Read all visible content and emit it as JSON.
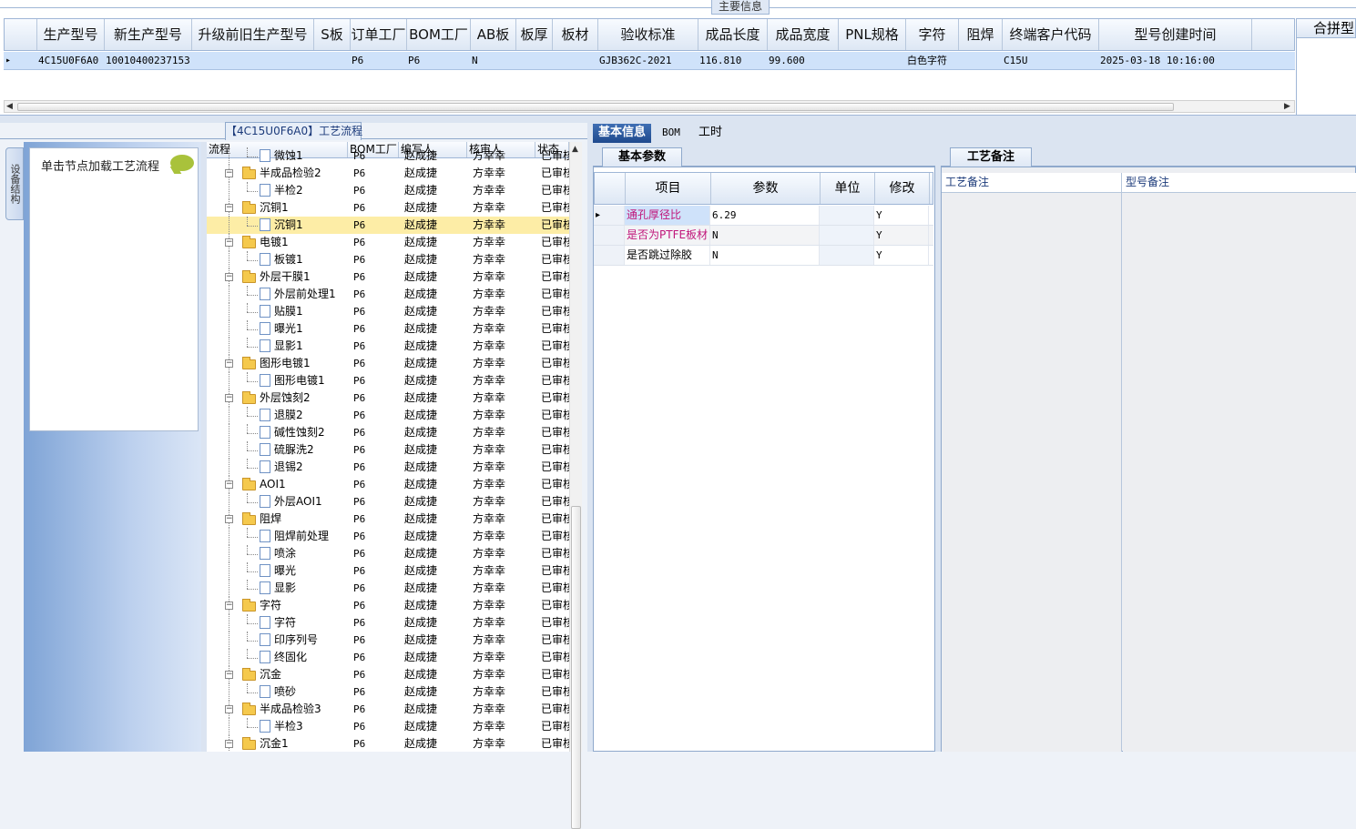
{
  "top_panel": {
    "title": "主要信息",
    "columns": [
      "生产型号",
      "新生产型号",
      "升级前旧生产型号",
      "S板",
      "订单工厂",
      "BOM工厂",
      "AB板",
      "板厚",
      "板材",
      "验收标准",
      "成品长度",
      "成品宽度",
      "PNL规格",
      "字符",
      "阻焊",
      "终端客户代码",
      "型号创建时间"
    ],
    "row": [
      "4C15U0F6A0",
      "10010400237153",
      "",
      "",
      "P6",
      "P6",
      "N",
      "",
      "",
      "GJB362C-2021",
      "116.810",
      "99.600",
      "",
      "白色字符",
      "",
      "C15U",
      "2025-03-18 10:16:00"
    ],
    "merge_header": "合拼型"
  },
  "flow_panel": {
    "title": "【4C15U0F6A0】工艺流程",
    "side_tab": "设备结构",
    "node_hint": "单击节点加载工艺流程",
    "columns": [
      "流程",
      "BOM工厂",
      "编写人",
      "核审人",
      "状态"
    ],
    "rows": [
      {
        "label": "微蚀1",
        "level": 2,
        "type": "doc",
        "bom": "P6",
        "writer": "赵成捷",
        "reviewer": "方幸幸",
        "status": "已审核"
      },
      {
        "label": "半成品检验2",
        "level": 1,
        "type": "folder",
        "bom": "P6",
        "writer": "赵成捷",
        "reviewer": "方幸幸",
        "status": "已审核"
      },
      {
        "label": "半检2",
        "level": 2,
        "type": "doc",
        "bom": "P6",
        "writer": "赵成捷",
        "reviewer": "方幸幸",
        "status": "已审核"
      },
      {
        "label": "沉铜1",
        "level": 1,
        "type": "folder",
        "bom": "P6",
        "writer": "赵成捷",
        "reviewer": "方幸幸",
        "status": "已审核"
      },
      {
        "label": "沉铜1",
        "level": 2,
        "type": "doc",
        "bom": "P6",
        "writer": "赵成捷",
        "reviewer": "方幸幸",
        "status": "已审核",
        "selected": true
      },
      {
        "label": "电镀1",
        "level": 1,
        "type": "folder",
        "bom": "P6",
        "writer": "赵成捷",
        "reviewer": "方幸幸",
        "status": "已审核"
      },
      {
        "label": "板镀1",
        "level": 2,
        "type": "doc",
        "bom": "P6",
        "writer": "赵成捷",
        "reviewer": "方幸幸",
        "status": "已审核"
      },
      {
        "label": "外层干膜1",
        "level": 1,
        "type": "folder",
        "bom": "P6",
        "writer": "赵成捷",
        "reviewer": "方幸幸",
        "status": "已审核"
      },
      {
        "label": "外层前处理1",
        "level": 2,
        "type": "doc",
        "bom": "P6",
        "writer": "赵成捷",
        "reviewer": "方幸幸",
        "status": "已审核"
      },
      {
        "label": "贴膜1",
        "level": 2,
        "type": "doc",
        "bom": "P6",
        "writer": "赵成捷",
        "reviewer": "方幸幸",
        "status": "已审核"
      },
      {
        "label": "曝光1",
        "level": 2,
        "type": "doc",
        "bom": "P6",
        "writer": "赵成捷",
        "reviewer": "方幸幸",
        "status": "已审核"
      },
      {
        "label": "显影1",
        "level": 2,
        "type": "doc",
        "bom": "P6",
        "writer": "赵成捷",
        "reviewer": "方幸幸",
        "status": "已审核"
      },
      {
        "label": "图形电镀1",
        "level": 1,
        "type": "folder",
        "bom": "P6",
        "writer": "赵成捷",
        "reviewer": "方幸幸",
        "status": "已审核"
      },
      {
        "label": "图形电镀1",
        "level": 2,
        "type": "doc",
        "bom": "P6",
        "writer": "赵成捷",
        "reviewer": "方幸幸",
        "status": "已审核"
      },
      {
        "label": "外层蚀刻2",
        "level": 1,
        "type": "folder",
        "bom": "P6",
        "writer": "赵成捷",
        "reviewer": "方幸幸",
        "status": "已审核"
      },
      {
        "label": "退膜2",
        "level": 2,
        "type": "doc",
        "bom": "P6",
        "writer": "赵成捷",
        "reviewer": "方幸幸",
        "status": "已审核"
      },
      {
        "label": "碱性蚀刻2",
        "level": 2,
        "type": "doc",
        "bom": "P6",
        "writer": "赵成捷",
        "reviewer": "方幸幸",
        "status": "已审核"
      },
      {
        "label": "硫脲洗2",
        "level": 2,
        "type": "doc",
        "bom": "P6",
        "writer": "赵成捷",
        "reviewer": "方幸幸",
        "status": "已审核"
      },
      {
        "label": "退锡2",
        "level": 2,
        "type": "doc",
        "bom": "P6",
        "writer": "赵成捷",
        "reviewer": "方幸幸",
        "status": "已审核"
      },
      {
        "label": "AOI1",
        "level": 1,
        "type": "folder",
        "bom": "P6",
        "writer": "赵成捷",
        "reviewer": "方幸幸",
        "status": "已审核"
      },
      {
        "label": "外层AOI1",
        "level": 2,
        "type": "doc",
        "bom": "P6",
        "writer": "赵成捷",
        "reviewer": "方幸幸",
        "status": "已审核"
      },
      {
        "label": "阻焊",
        "level": 1,
        "type": "folder",
        "bom": "P6",
        "writer": "赵成捷",
        "reviewer": "方幸幸",
        "status": "已审核"
      },
      {
        "label": "阻焊前处理",
        "level": 2,
        "type": "doc",
        "bom": "P6",
        "writer": "赵成捷",
        "reviewer": "方幸幸",
        "status": "已审核"
      },
      {
        "label": "喷涂",
        "level": 2,
        "type": "doc",
        "bom": "P6",
        "writer": "赵成捷",
        "reviewer": "方幸幸",
        "status": "已审核"
      },
      {
        "label": "曝光",
        "level": 2,
        "type": "doc",
        "bom": "P6",
        "writer": "赵成捷",
        "reviewer": "方幸幸",
        "status": "已审核"
      },
      {
        "label": "显影",
        "level": 2,
        "type": "doc",
        "bom": "P6",
        "writer": "赵成捷",
        "reviewer": "方幸幸",
        "status": "已审核"
      },
      {
        "label": "字符",
        "level": 1,
        "type": "folder",
        "bom": "P6",
        "writer": "赵成捷",
        "reviewer": "方幸幸",
        "status": "已审核"
      },
      {
        "label": "字符",
        "level": 2,
        "type": "doc",
        "bom": "P6",
        "writer": "赵成捷",
        "reviewer": "方幸幸",
        "status": "已审核"
      },
      {
        "label": "印序列号",
        "level": 2,
        "type": "doc",
        "bom": "P6",
        "writer": "赵成捷",
        "reviewer": "方幸幸",
        "status": "已审核"
      },
      {
        "label": "终固化",
        "level": 2,
        "type": "doc",
        "bom": "P6",
        "writer": "赵成捷",
        "reviewer": "方幸幸",
        "status": "已审核"
      },
      {
        "label": "沉金",
        "level": 1,
        "type": "folder",
        "bom": "P6",
        "writer": "赵成捷",
        "reviewer": "方幸幸",
        "status": "已审核"
      },
      {
        "label": "喷砂",
        "level": 2,
        "type": "doc",
        "bom": "P6",
        "writer": "赵成捷",
        "reviewer": "方幸幸",
        "status": "已审核"
      },
      {
        "label": "半成品检验3",
        "level": 1,
        "type": "folder",
        "bom": "P6",
        "writer": "赵成捷",
        "reviewer": "方幸幸",
        "status": "已审核"
      },
      {
        "label": "半检3",
        "level": 2,
        "type": "doc",
        "bom": "P6",
        "writer": "赵成捷",
        "reviewer": "方幸幸",
        "status": "已审核"
      },
      {
        "label": "沉金1",
        "level": 1,
        "type": "folder",
        "bom": "P6",
        "writer": "赵成捷",
        "reviewer": "方幸幸",
        "status": "已审核"
      }
    ]
  },
  "detail_tabs": [
    "基本信息",
    "BOM",
    "工时"
  ],
  "params": {
    "subtab": "基本参数",
    "columns": [
      "项目",
      "参数",
      "单位",
      "修改"
    ],
    "rows": [
      {
        "item": "通孔厚径比",
        "value": "6.29",
        "unit": "",
        "modify": "Y",
        "color": "#c0157a"
      },
      {
        "item": "是否为PTFE板材",
        "value": "N",
        "unit": "",
        "modify": "Y",
        "color": "#c0157a"
      },
      {
        "item": "是否跳过除胶",
        "value": "N",
        "unit": "",
        "modify": "Y",
        "color": "#000000"
      }
    ]
  },
  "notes": {
    "tab": "工艺备注",
    "columns": [
      "工艺备注",
      "型号备注"
    ]
  }
}
